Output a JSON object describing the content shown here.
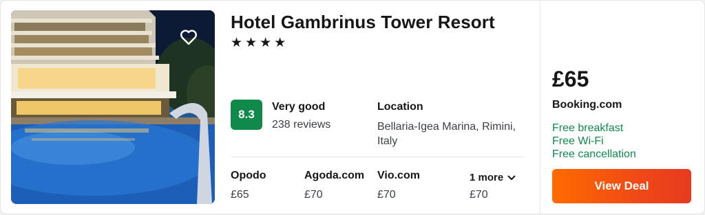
{
  "hotel": {
    "name": "Hotel Gambrinus Tower Resort",
    "stars": "★★★★",
    "photo_icon": "hotel-photo"
  },
  "rating": {
    "score": "8.3",
    "label": "Very good",
    "reviews": "238 reviews",
    "score_color": "#0f8a4a"
  },
  "location": {
    "heading": "Location",
    "text": "Bellaria-Igea Marina, Rimini, Italy"
  },
  "providers": [
    {
      "name": "Opodo",
      "price": "£65"
    },
    {
      "name": "Agoda.com",
      "price": "£70"
    },
    {
      "name": "Vio.com",
      "price": "£70"
    }
  ],
  "more": {
    "label": "1 more",
    "price": "£70",
    "icon": "chevron-down-icon"
  },
  "deal": {
    "price": "£65",
    "provider": "Booking.com",
    "perks": [
      "Free breakfast",
      "Free Wi-Fi",
      "Free cancellation"
    ],
    "button_label": "View Deal",
    "button_color": "#f04a16",
    "perk_color": "#0f8a4a"
  },
  "favorite": {
    "icon": "heart-icon"
  }
}
